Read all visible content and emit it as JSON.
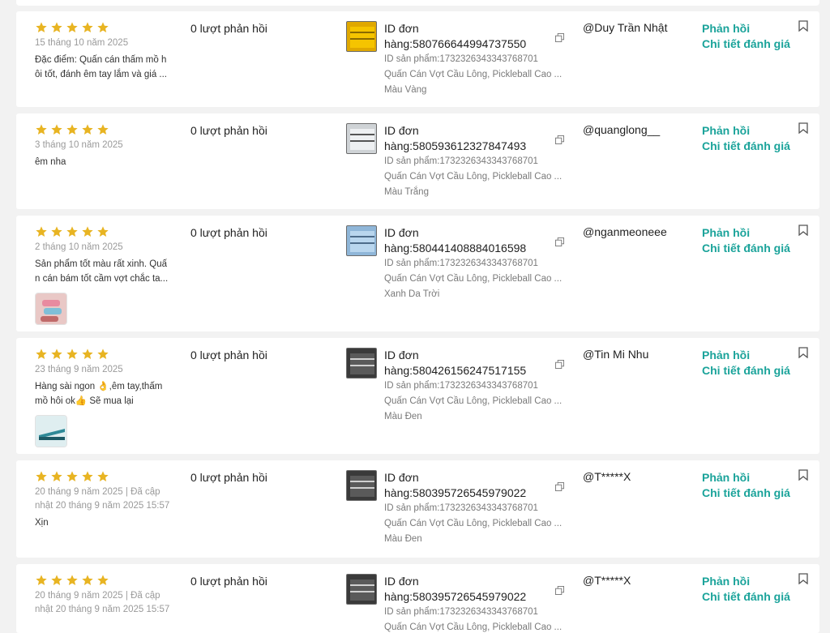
{
  "reviews": [
    {
      "date": "15 tháng 10 năm 2025",
      "comment": "Đặc điểm: Quấn cán thấm mồ h ôi tốt, đánh êm tay lắm và giá ...",
      "reply_count": "0 lượt phản hồi",
      "order_id": "hàng:580766644994737550",
      "product_id": "ID sản phẩm:1732326343343768701",
      "product_name": "Quấn Cán Vợt Cầu Lông, Pickleball Cao ...",
      "variant": "Màu Vàng",
      "username": "@Duy Trần Nhật",
      "thumb_color": "#e0a800"
    },
    {
      "date": "3 tháng 10 năm 2025",
      "comment": "êm nha",
      "reply_count": "0 lượt phản hồi",
      "order_id": "hàng:580593612327847493",
      "product_id": "ID sản phẩm:1732326343343768701",
      "product_name": "Quấn Cán Vợt Cầu Lông, Pickleball Cao ...",
      "variant": "Màu Trắng",
      "username": "@quanglong__",
      "thumb_color": "#d8d8d8"
    },
    {
      "date": "2 tháng 10 năm 2025",
      "comment": "Sản phẩm tốt màu rất xinh. Quấ n cán bám tốt cầm vợt chắc ta...",
      "reply_count": "0 lượt phản hồi",
      "order_id": "hàng:580441408884016598",
      "product_id": "ID sản phẩm:1732326343343768701",
      "product_name": "Quấn Cán Vợt Cầu Lông, Pickleball Cao ...",
      "variant": "Xanh Da Trời",
      "username": "@nganmeoneee",
      "thumb_color": "#9fc4e0"
    },
    {
      "date": "23 tháng 9 năm 2025",
      "comment": "Hàng sài ngon 👌,êm tay,thấm mồ hôi ok👍 Sẽ mua lại",
      "reply_count": "0 lượt phản hồi",
      "order_id": "hàng:580426156247517155",
      "product_id": "ID sản phẩm:1732326343343768701",
      "product_name": "Quấn Cán Vợt Cầu Lông, Pickleball Cao ...",
      "variant": "Màu Đen",
      "username": "@Tin Mi Nhu",
      "thumb_color": "#3a3a3a"
    },
    {
      "date": "20 tháng 9 năm 2025 | Đã cập nhật 20 tháng 9 năm 2025 15:57",
      "comment": "Xịn",
      "reply_count": "0 lượt phản hồi",
      "order_id": "hàng:580395726545979022",
      "product_id": "ID sản phẩm:1732326343343768701",
      "product_name": "Quấn Cán Vợt Cầu Lông, Pickleball Cao ...",
      "variant": "Màu Đen",
      "username": "@T*****X",
      "thumb_color": "#3a3a3a"
    },
    {
      "date": "20 tháng 9 năm 2025 | Đã cập nhật 20 tháng 9 năm 2025 15:57",
      "comment": "",
      "reply_count": "0 lượt phản hồi",
      "order_id": "hàng:580395726545979022",
      "product_id": "ID sản phẩm:1732326343343768701",
      "product_name": "Quấn Cán Vợt Cầu Lông, Pickleball Cao ...",
      "variant": "",
      "username": "@T*****X",
      "thumb_color": "#3a3a3a"
    }
  ],
  "labels": {
    "order_id_prefix": "ID đơn",
    "reply_action": "Phản hồi",
    "details_action": "Chi tiết đánh giá"
  },
  "colors": {
    "star": "#e8b422",
    "action": "#1aa39a"
  }
}
